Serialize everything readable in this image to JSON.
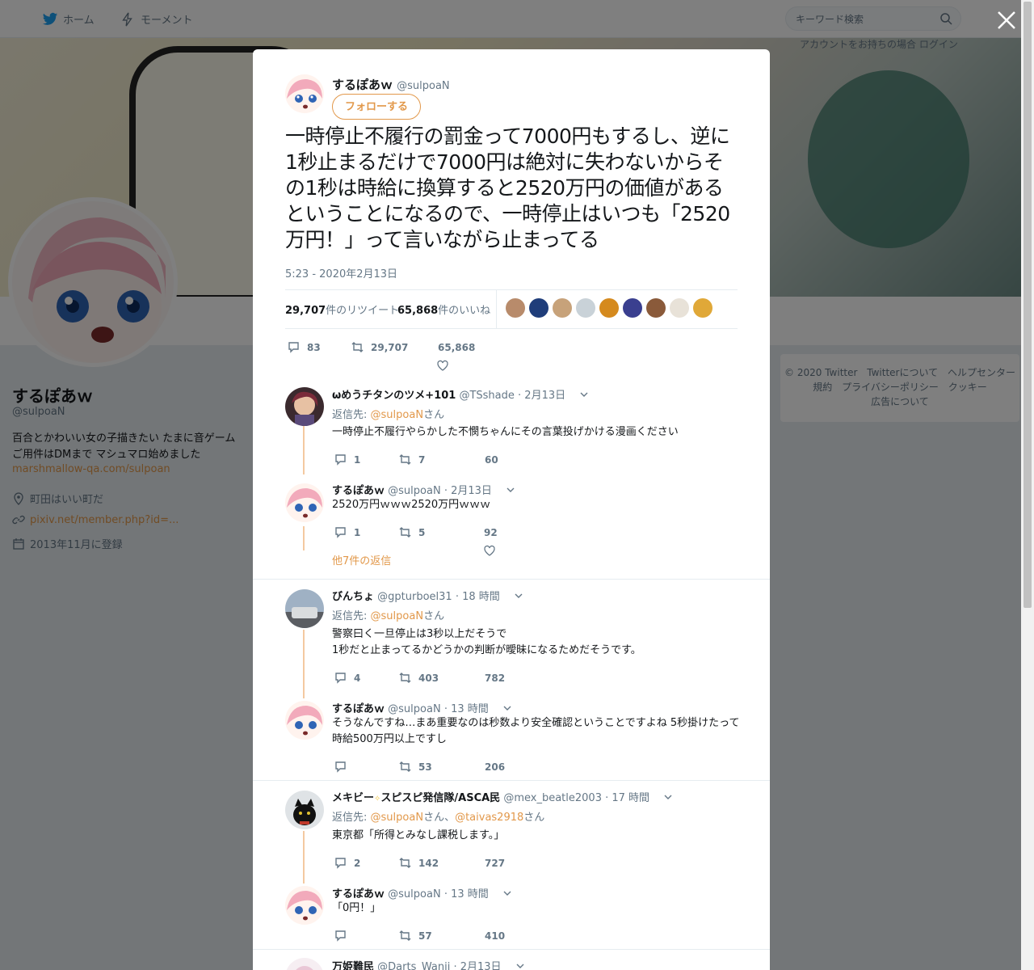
{
  "nav": {
    "home": "ホーム",
    "moments": "モーメント",
    "search_placeholder": "キーワード検索",
    "login_text": "アカウントをお持ちの場合 ログイン"
  },
  "profile": {
    "name": "するぽあｗ",
    "handle": "@sulpoaN",
    "bio": "百合とかわいい女の子描きたい たまに音ゲーム ご用件はDMまで マシュマロ始めました",
    "bio_link": "marshmallow-qa.com/sulpoan",
    "location": "町田はいい町だ",
    "website": "pixiv.net/member.php?id=...",
    "joined": "2013年11月に登録"
  },
  "footer": {
    "links": [
      "© 2020 Twitter",
      "Twitterについて",
      "ヘルプセンター",
      "規約",
      "プライバシーポリシー",
      "クッキー",
      "広告について"
    ]
  },
  "main_tweet": {
    "name": "するぽあｗ",
    "handle": "@sulpoaN",
    "follow_label": "フォローする",
    "text": "一時停止不履行の罰金って7000円もするし、逆に1秒止まるだけで7000円は絶対に失わないからその1秒は時給に換算すると2520万円の価値があるということになるので、一時停止はいつも「2520万円！」って言いながら止まってる",
    "time": "5:23 - 2020年2月13日",
    "retweets": "29,707",
    "retweets_label": "件のリツイート",
    "likes": "65,868",
    "likes_label": "件のいいね",
    "reply_count": "83",
    "retweet_count": "29,707",
    "like_count": "65,868",
    "liker_colors": [
      "#b88b6b",
      "#1f3d7a",
      "#c7a27a",
      "#c9d2d8",
      "#d58a1e",
      "#3a3f8f",
      "#8a5a3a",
      "#e8e2d8",
      "#e0a838"
    ]
  },
  "replies": [
    {
      "name": "ωめうチタンのツメ+101",
      "handle": "@TSshade",
      "time": "· 2月13日",
      "reply_to_label": "返信先:",
      "reply_to": "@sulpoaN",
      "reply_to_suffix": "さん",
      "text": "一時停止不履行やらかした不憫ちゃんにその言葉投げかける漫画ください",
      "replies": "1",
      "retweets": "7",
      "likes": "60"
    },
    {
      "name": "するぽあｗ",
      "handle": "@sulpoaN",
      "time": "· 2月13日",
      "text": "2520万円ｗｗｗ2520万円ｗｗｗ",
      "replies": "1",
      "retweets": "5",
      "likes": "92",
      "more_label": "他7件の返信"
    },
    {
      "name": "びんちょ",
      "handle": "@gpturboel31",
      "time": "· 18 時間",
      "reply_to_label": "返信先:",
      "reply_to": "@sulpoaN",
      "reply_to_suffix": "さん",
      "text": "警察曰く一旦停止は3秒以上だそうで 1秒だと止まってるかどうかの判断が曖昧になるためだそうです。",
      "text_line1": "警察曰く一旦停止は3秒以上だそうで",
      "text_line2": "1秒だと止まってるかどうかの判断が曖昧になるためだそうです。",
      "replies": "4",
      "retweets": "403",
      "likes": "782"
    },
    {
      "name": "するぽあｗ",
      "handle": "@sulpoaN",
      "time": "· 13 時間",
      "text": "そうなんですね…まあ重要なのは秒数より安全確認ということですよね 5秒掛けたって時給500万円以上ですし",
      "replies": "",
      "retweets": "53",
      "likes": "206"
    },
    {
      "name": "メキビー",
      "name_suffix": "スピスピ発信隊/ASCA民",
      "handle": "@mex_beatle2003",
      "time": "· 17 時間",
      "reply_to_label": "返信先:",
      "reply_to": "@sulpoaN",
      "reply_to_mid": "さん、",
      "reply_to2": "@taivas2918",
      "reply_to_suffix": "さん",
      "text": "東京都「所得とみなし課税します。」",
      "replies": "2",
      "retweets": "142",
      "likes": "727"
    },
    {
      "name": "するぽあｗ",
      "handle": "@sulpoaN",
      "time": "· 13 時間",
      "text": "「0円！」",
      "replies": "",
      "retweets": "57",
      "likes": "410"
    },
    {
      "name": "万姫難民",
      "handle": "@Darts_Wanji",
      "time": "· 2月13日"
    }
  ]
}
